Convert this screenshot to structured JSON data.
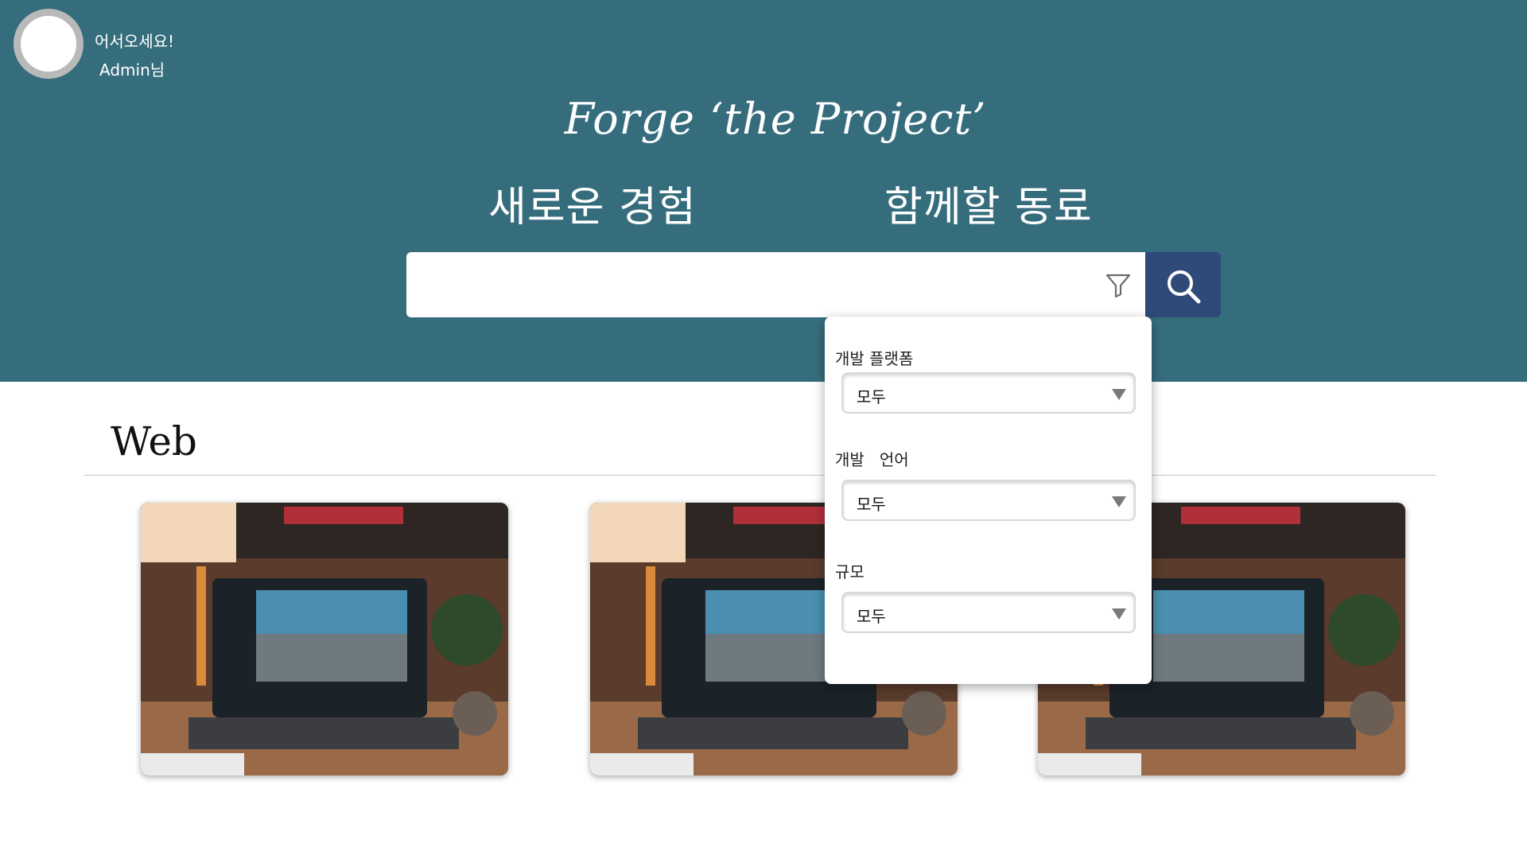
{
  "header": {
    "greeting_line1": "어서오세요!",
    "greeting_line2": "Admin님",
    "brand": "Forge ‘the Project’",
    "tagline_left": "새로운 경험",
    "tagline_right": "함께할 동료"
  },
  "search": {
    "value": "",
    "filter_icon": "filter-icon",
    "button_icon": "search-icon"
  },
  "filter_panel": {
    "fields": [
      {
        "label": "개발 플랫폼",
        "value": "모두"
      },
      {
        "label": "개발   언어",
        "value": "모두"
      },
      {
        "label": "규모",
        "value": "모두"
      }
    ]
  },
  "section": {
    "title": "Web",
    "cards": [
      {
        "image": "laptop-desk-photo"
      },
      {
        "image": "laptop-desk-photo"
      },
      {
        "image": "laptop-desk-photo"
      }
    ]
  },
  "colors": {
    "header_bg": "#366d7d",
    "search_button": "#2f4979",
    "page_bg": "#ffffff"
  }
}
